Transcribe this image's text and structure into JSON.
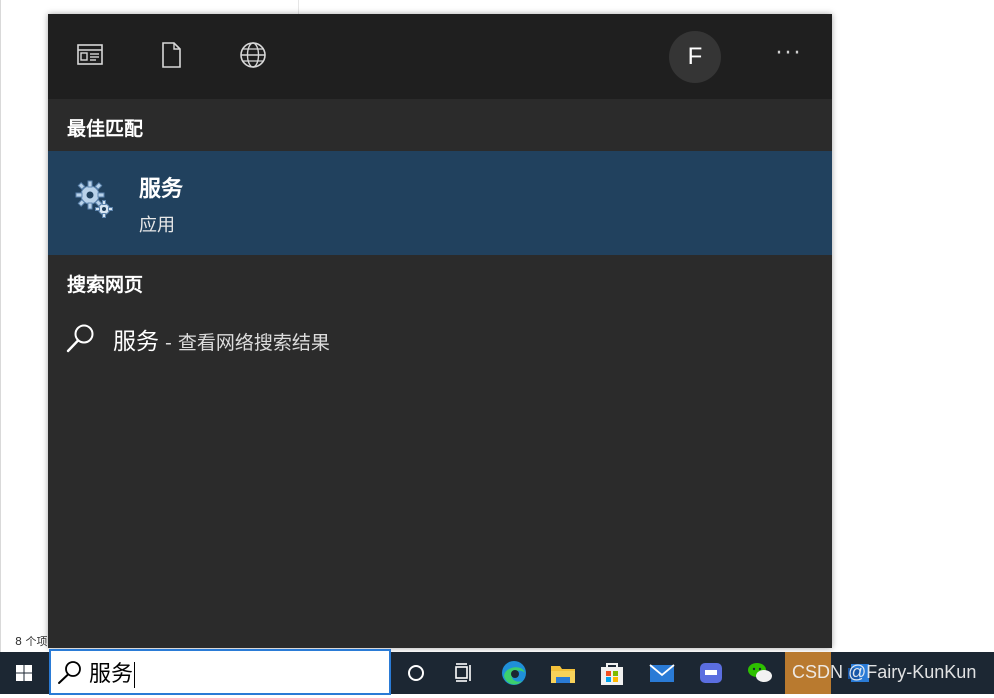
{
  "background": {
    "status_text": "8 个项"
  },
  "panel": {
    "top_icons": [
      "apps-filter-icon",
      "documents-filter-icon",
      "web-filter-icon"
    ],
    "avatar_letter": "F",
    "more_label": "···",
    "best_match_title": "最佳匹配",
    "best_match": {
      "name": "服务",
      "type": "应用",
      "icon": "services-gear-icon"
    },
    "web_title": "搜索网页",
    "web_result": {
      "query": "服务",
      "suffix": " - 查看网络搜索结果"
    },
    "colors": {
      "panel": "#2b2b2b",
      "topbar": "#1f1f1f",
      "selected": "#21415e"
    }
  },
  "taskbar": {
    "search_value": "服务",
    "icons": [
      "windows-start-icon",
      "cortana-icon",
      "task-view-icon",
      "edge-icon",
      "file-explorer-icon",
      "store-icon",
      "mail-icon",
      "app-icon",
      "wechat-icon"
    ],
    "watermark": "CSDN @Fairy-KunKun"
  }
}
